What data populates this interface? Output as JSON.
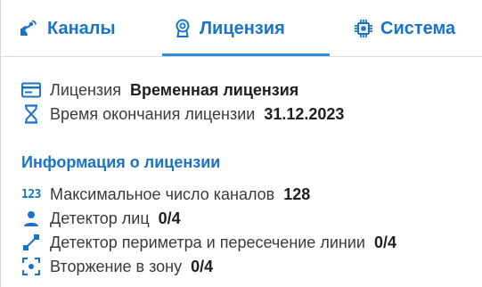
{
  "tabs": [
    {
      "label": "Каналы",
      "icon": "satellite-dish-icon"
    },
    {
      "label": "Лицензия",
      "icon": "license-badge-icon",
      "active": true
    },
    {
      "label": "Система",
      "icon": "chip-icon"
    }
  ],
  "license": {
    "type_label": "Лицензия",
    "type_value": "Временная лицензия",
    "expiry_label": "Время окончания лицензии",
    "expiry_value": "31.12.2023"
  },
  "info": {
    "title": "Информация о лицензии",
    "items": [
      {
        "icon": "numbers-123-icon",
        "label": "Максимальное число каналов",
        "value": "128"
      },
      {
        "icon": "person-icon",
        "label": "Детектор лиц",
        "value": "0/4"
      },
      {
        "icon": "line-crossing-icon",
        "label": "Детектор периметра и пересечение линии",
        "value": "0/4"
      },
      {
        "icon": "zone-intrusion-icon",
        "label": "Вторжение в зону",
        "value": "0/4"
      }
    ]
  },
  "colors": {
    "accent": "#1a73c8",
    "underline": "#2f8be3"
  }
}
